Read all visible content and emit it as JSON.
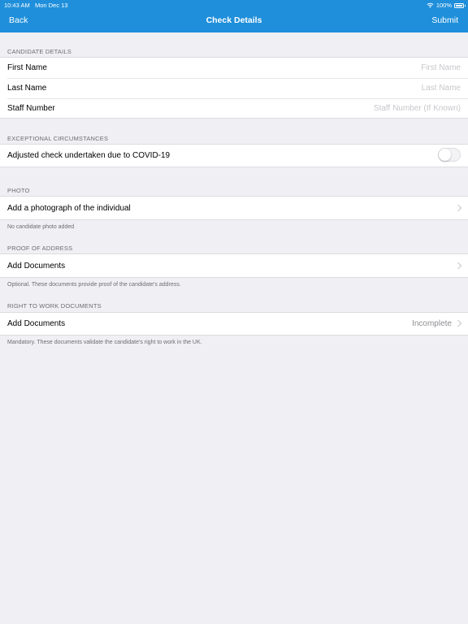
{
  "status_bar": {
    "time": "10:43 AM",
    "date": "Mon Dec 13",
    "battery": "100%"
  },
  "nav": {
    "back_label": "Back",
    "title": "Check Details",
    "submit_label": "Submit"
  },
  "candidate": {
    "header": "CANDIDATE DETAILS",
    "first_name": {
      "label": "First Name",
      "placeholder": "First Name"
    },
    "last_name": {
      "label": "Last Name",
      "placeholder": "Last Name"
    },
    "staff_number": {
      "label": "Staff Number",
      "placeholder": "Staff Number (If Known)"
    }
  },
  "exceptional": {
    "header": "EXCEPTIONAL CIRCUMSTANCES",
    "covid_label": "Adjusted check undertaken due to COVID-19",
    "covid_on": false
  },
  "photo": {
    "header": "PHOTO",
    "add_label": "Add a photograph of the individual",
    "note": "No candidate photo added"
  },
  "proof_of_address": {
    "header": "PROOF OF ADDRESS",
    "add_label": "Add Documents",
    "note": "Optional. These documents provide proof of the candidate's address."
  },
  "right_to_work": {
    "header": "RIGHT TO WORK DOCUMENTS",
    "add_label": "Add Documents",
    "status": "Incomplete",
    "note": "Mandatory. These documents validate the candidate's right to work in the UK."
  },
  "colors": {
    "accent": "#1f8fdb",
    "background": "#efeff4"
  }
}
